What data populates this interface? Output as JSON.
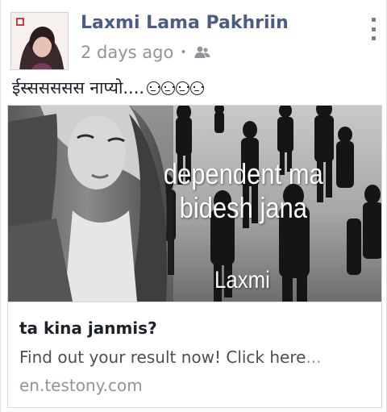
{
  "post": {
    "author": "Laxmi Lama Pakhriin",
    "timestamp": "2 days ago",
    "separator": "•",
    "audience_icon": "friends-icon",
    "more_icon": "more-vertical-icon",
    "status_text": "ईस्ससससस नाप्यो....",
    "emojis": [
      "unamused-face",
      "unamused-face",
      "tired-face",
      "tired-face"
    ]
  },
  "link_card": {
    "image_text_line1": "dependent ma",
    "image_text_line2": "bidesh jana",
    "image_name": "Laxmi",
    "title": "ta kina janmis?",
    "description": "Find out your result now! Click here",
    "description_ellipsis": "...",
    "domain": "en.testony.com"
  },
  "colors": {
    "author": "#4b5d83",
    "meta": "#90949c",
    "card_border": "#d6d8dc"
  }
}
